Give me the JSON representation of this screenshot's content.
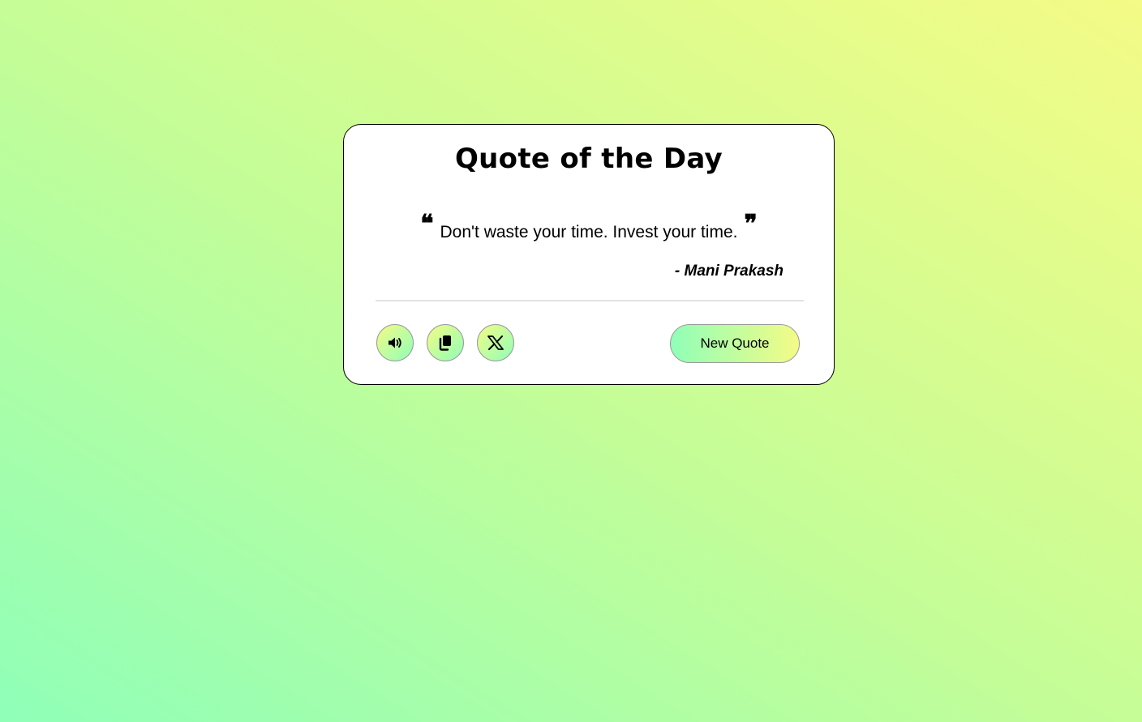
{
  "card": {
    "title": "Quote of the Day",
    "quote_open_mark": "❝",
    "quote_text": "Don't waste your time. Invest your time.",
    "quote_close_mark": "❞",
    "author": "- Mani Prakash"
  },
  "actions": {
    "speak_icon": "volume-icon",
    "copy_icon": "copy-icon",
    "share_icon": "x-twitter-icon",
    "new_quote_label": "New Quote"
  },
  "colors": {
    "gradient_start": "#8fffb8",
    "gradient_end": "#f4fb86",
    "card_background": "#ffffff",
    "divider": "#e2e2e2"
  }
}
